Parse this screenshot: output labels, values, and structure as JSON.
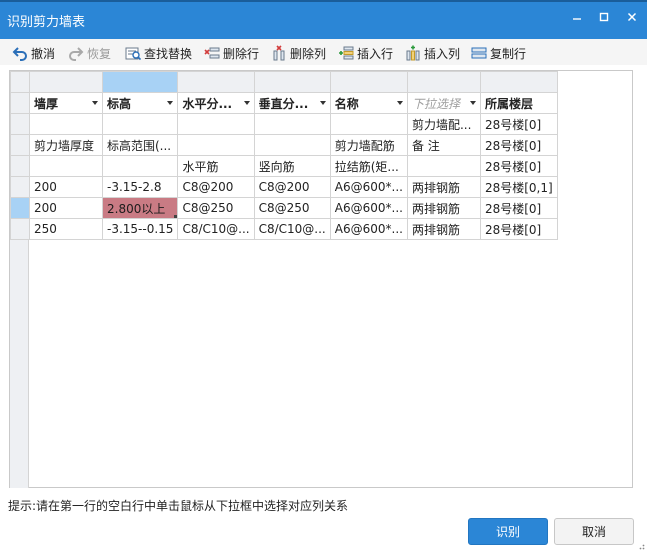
{
  "window": {
    "title": "识别剪力墙表",
    "minimize": "‒",
    "maximize": "□",
    "close": "✕"
  },
  "toolbar": {
    "undo": "撤消",
    "redo": "恢复",
    "find_replace": "查找替换",
    "delete_row": "删除行",
    "delete_col": "删除列",
    "insert_row": "插入行",
    "insert_col": "插入列",
    "copy_row": "复制行"
  },
  "colors": {
    "accent": "#2b86d6",
    "highlight_cell": "#c97b84",
    "selection": "#a8d2f5"
  },
  "grid": {
    "headers": [
      "墙厚",
      "标高",
      "水平分...",
      "垂直分...",
      "名称",
      "下拉选择",
      "所属楼层"
    ],
    "rows": [
      [
        "",
        "",
        "",
        "",
        "",
        "剪力墙配...",
        "28号楼[0]"
      ],
      [
        "剪力墙厚度",
        "标高范围(...",
        "",
        "",
        "剪力墙配筋",
        "备 注",
        "28号楼[0]"
      ],
      [
        "",
        "",
        "水平筋",
        "竖向筋",
        "拉结筋(矩...",
        "",
        "28号楼[0]"
      ],
      [
        "200",
        "-3.15-2.8",
        "C8@200",
        "C8@200",
        "A6@600*...",
        "两排钢筋",
        "28号楼[0,1]"
      ],
      [
        "200",
        "2.800以上",
        "C8@250",
        "C8@250",
        "A6@600*...",
        "两排钢筋",
        "28号楼[0]"
      ],
      [
        "250",
        "-3.15--0.15",
        "C8/C10@...",
        "C8/C10@...",
        "A6@600*...",
        "两排钢筋",
        "28号楼[0]"
      ]
    ]
  },
  "hint": "提示:请在第一行的空白行中单击鼠标从下拉框中选择对应列关系",
  "buttons": {
    "confirm": "识别",
    "cancel": "取消"
  }
}
